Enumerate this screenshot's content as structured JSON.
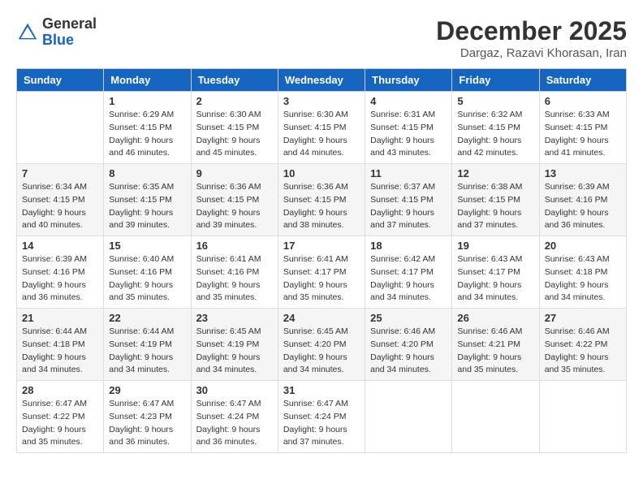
{
  "header": {
    "logo_general": "General",
    "logo_blue": "Blue",
    "month": "December 2025",
    "location": "Dargaz, Razavi Khorasan, Iran"
  },
  "weekdays": [
    "Sunday",
    "Monday",
    "Tuesday",
    "Wednesday",
    "Thursday",
    "Friday",
    "Saturday"
  ],
  "weeks": [
    [
      {
        "day": "",
        "info": ""
      },
      {
        "day": "1",
        "info": "Sunrise: 6:29 AM\nSunset: 4:15 PM\nDaylight: 9 hours\nand 46 minutes."
      },
      {
        "day": "2",
        "info": "Sunrise: 6:30 AM\nSunset: 4:15 PM\nDaylight: 9 hours\nand 45 minutes."
      },
      {
        "day": "3",
        "info": "Sunrise: 6:30 AM\nSunset: 4:15 PM\nDaylight: 9 hours\nand 44 minutes."
      },
      {
        "day": "4",
        "info": "Sunrise: 6:31 AM\nSunset: 4:15 PM\nDaylight: 9 hours\nand 43 minutes."
      },
      {
        "day": "5",
        "info": "Sunrise: 6:32 AM\nSunset: 4:15 PM\nDaylight: 9 hours\nand 42 minutes."
      },
      {
        "day": "6",
        "info": "Sunrise: 6:33 AM\nSunset: 4:15 PM\nDaylight: 9 hours\nand 41 minutes."
      }
    ],
    [
      {
        "day": "7",
        "info": "Sunrise: 6:34 AM\nSunset: 4:15 PM\nDaylight: 9 hours\nand 40 minutes."
      },
      {
        "day": "8",
        "info": "Sunrise: 6:35 AM\nSunset: 4:15 PM\nDaylight: 9 hours\nand 39 minutes."
      },
      {
        "day": "9",
        "info": "Sunrise: 6:36 AM\nSunset: 4:15 PM\nDaylight: 9 hours\nand 39 minutes."
      },
      {
        "day": "10",
        "info": "Sunrise: 6:36 AM\nSunset: 4:15 PM\nDaylight: 9 hours\nand 38 minutes."
      },
      {
        "day": "11",
        "info": "Sunrise: 6:37 AM\nSunset: 4:15 PM\nDaylight: 9 hours\nand 37 minutes."
      },
      {
        "day": "12",
        "info": "Sunrise: 6:38 AM\nSunset: 4:15 PM\nDaylight: 9 hours\nand 37 minutes."
      },
      {
        "day": "13",
        "info": "Sunrise: 6:39 AM\nSunset: 4:16 PM\nDaylight: 9 hours\nand 36 minutes."
      }
    ],
    [
      {
        "day": "14",
        "info": "Sunrise: 6:39 AM\nSunset: 4:16 PM\nDaylight: 9 hours\nand 36 minutes."
      },
      {
        "day": "15",
        "info": "Sunrise: 6:40 AM\nSunset: 4:16 PM\nDaylight: 9 hours\nand 35 minutes."
      },
      {
        "day": "16",
        "info": "Sunrise: 6:41 AM\nSunset: 4:16 PM\nDaylight: 9 hours\nand 35 minutes."
      },
      {
        "day": "17",
        "info": "Sunrise: 6:41 AM\nSunset: 4:17 PM\nDaylight: 9 hours\nand 35 minutes."
      },
      {
        "day": "18",
        "info": "Sunrise: 6:42 AM\nSunset: 4:17 PM\nDaylight: 9 hours\nand 34 minutes."
      },
      {
        "day": "19",
        "info": "Sunrise: 6:43 AM\nSunset: 4:17 PM\nDaylight: 9 hours\nand 34 minutes."
      },
      {
        "day": "20",
        "info": "Sunrise: 6:43 AM\nSunset: 4:18 PM\nDaylight: 9 hours\nand 34 minutes."
      }
    ],
    [
      {
        "day": "21",
        "info": "Sunrise: 6:44 AM\nSunset: 4:18 PM\nDaylight: 9 hours\nand 34 minutes."
      },
      {
        "day": "22",
        "info": "Sunrise: 6:44 AM\nSunset: 4:19 PM\nDaylight: 9 hours\nand 34 minutes."
      },
      {
        "day": "23",
        "info": "Sunrise: 6:45 AM\nSunset: 4:19 PM\nDaylight: 9 hours\nand 34 minutes."
      },
      {
        "day": "24",
        "info": "Sunrise: 6:45 AM\nSunset: 4:20 PM\nDaylight: 9 hours\nand 34 minutes."
      },
      {
        "day": "25",
        "info": "Sunrise: 6:46 AM\nSunset: 4:20 PM\nDaylight: 9 hours\nand 34 minutes."
      },
      {
        "day": "26",
        "info": "Sunrise: 6:46 AM\nSunset: 4:21 PM\nDaylight: 9 hours\nand 35 minutes."
      },
      {
        "day": "27",
        "info": "Sunrise: 6:46 AM\nSunset: 4:22 PM\nDaylight: 9 hours\nand 35 minutes."
      }
    ],
    [
      {
        "day": "28",
        "info": "Sunrise: 6:47 AM\nSunset: 4:22 PM\nDaylight: 9 hours\nand 35 minutes."
      },
      {
        "day": "29",
        "info": "Sunrise: 6:47 AM\nSunset: 4:23 PM\nDaylight: 9 hours\nand 36 minutes."
      },
      {
        "day": "30",
        "info": "Sunrise: 6:47 AM\nSunset: 4:24 PM\nDaylight: 9 hours\nand 36 minutes."
      },
      {
        "day": "31",
        "info": "Sunrise: 6:47 AM\nSunset: 4:24 PM\nDaylight: 9 hours\nand 37 minutes."
      },
      {
        "day": "",
        "info": ""
      },
      {
        "day": "",
        "info": ""
      },
      {
        "day": "",
        "info": ""
      }
    ]
  ]
}
